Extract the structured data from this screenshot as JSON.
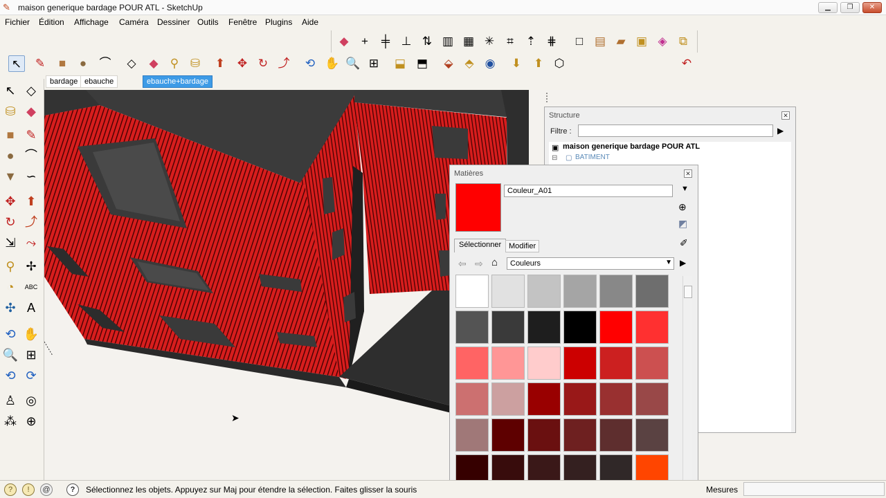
{
  "window": {
    "title": "maison generique bardage POUR ATL - SketchUp",
    "app_icon": "sketchup-pencil-icon"
  },
  "menu": [
    "Fichier",
    "Édition",
    "Affichage",
    "Caméra",
    "Dessiner",
    "Outils",
    "Fenêtre",
    "Plugins",
    "Aide"
  ],
  "scene_tabs": [
    {
      "label": "bardage",
      "active": false
    },
    {
      "label": "ebauche volume",
      "active": false
    },
    {
      "label": "ebauche+bardage",
      "active": true
    }
  ],
  "structure_panel": {
    "title": "Structure",
    "filter_label": "Filtre :",
    "filter_value": "",
    "root": "maison generique bardage POUR ATL",
    "child": "BATIMENT"
  },
  "materials_panel": {
    "title": "Matières",
    "material_name": "Couleur_A01",
    "current_color": "#ff0000",
    "tabs": [
      {
        "label": "Sélectionner",
        "active": true
      },
      {
        "label": "Modifier",
        "active": false
      }
    ],
    "library": "Couleurs",
    "swatches": [
      "#ffffff",
      "#e1e1e1",
      "#c3c3c3",
      "#a5a5a5",
      "#888888",
      "#6e6e6e",
      "#545454",
      "#3a3a3a",
      "#1e1e1e",
      "#000000",
      "#ff0000",
      "#ff3030",
      "#ff6464",
      "#ff9696",
      "#ffcccc",
      "#cc0000",
      "#cc2020",
      "#cc5050",
      "#cc7070",
      "#cca0a0",
      "#990000",
      "#991818",
      "#993030",
      "#994848",
      "#a07878",
      "#5e0000",
      "#6a1010",
      "#6e2020",
      "#5e2e2e",
      "#5a4242",
      "#360000",
      "#380c0c",
      "#3a1818",
      "#342020",
      "#302828",
      "#ff4500"
    ]
  },
  "status": {
    "message": "Sélectionnez les objets. Appuyez sur Maj pour étendre la sélection. Faites glisser la souris",
    "measures_label": "Mesures",
    "measures_value": ""
  },
  "colors": {
    "facade_red": "#d71d1d",
    "roof_gray": "#3a3a3a",
    "tab_active": "#3e9be6"
  }
}
